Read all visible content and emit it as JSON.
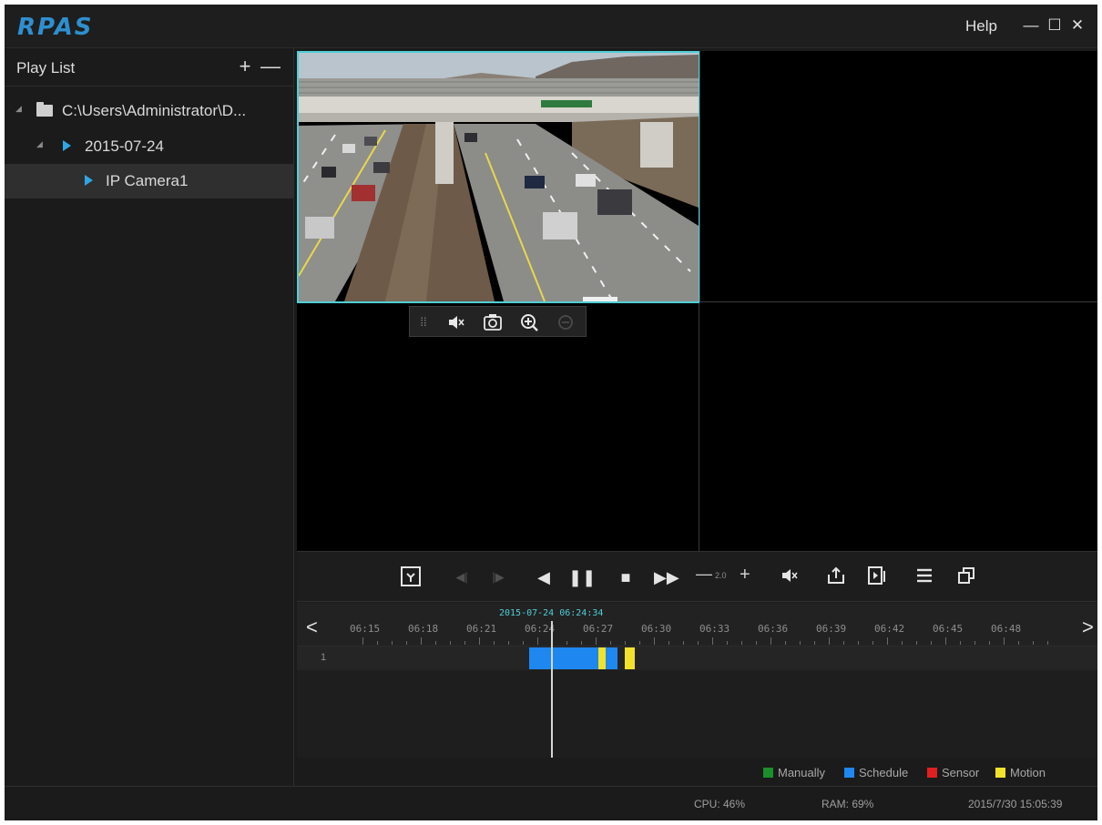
{
  "app": {
    "logo": "RPAS",
    "help": "Help"
  },
  "window_controls": {
    "minimize": "—",
    "maximize": "☐",
    "close": "✕"
  },
  "playlist": {
    "title": "Play List",
    "add": "+",
    "remove": "—",
    "tree": [
      {
        "label": "C:\\Users\\Administrator\\D...",
        "level": 0
      },
      {
        "label": "2015-07-24",
        "level": 1
      },
      {
        "label": "IP Camera1",
        "level": 2,
        "selected": true
      }
    ]
  },
  "video": {
    "sign_text": "",
    "overlay_toolbar": [
      "drag-handle",
      "mute",
      "snapshot",
      "zoom-in",
      "disabled"
    ]
  },
  "controls": {
    "speed_minus": "—",
    "speed_value": "2.0",
    "speed_plus": "+"
  },
  "timeline": {
    "current": "2015-07-24 06:24:34",
    "ticks": [
      "06:15",
      "06:18",
      "06:21",
      "06:24",
      "06:27",
      "06:30",
      "06:33",
      "06:36",
      "06:39",
      "06:42",
      "06:45",
      "06:48"
    ],
    "track_label": "1",
    "prev": "<",
    "next": ">",
    "segments": [
      {
        "type": "Schedule",
        "start": "06:23:35",
        "end": "06:28:08"
      },
      {
        "type": "Motion",
        "start": "06:27:08",
        "end": "06:27:30"
      },
      {
        "type": "Motion",
        "start": "06:28:30",
        "end": "06:29:00"
      }
    ]
  },
  "legend": [
    {
      "label": "Manually",
      "color": "#1a8f2a"
    },
    {
      "label": "Schedule",
      "color": "#1e87f0"
    },
    {
      "label": "Sensor",
      "color": "#e02020"
    },
    {
      "label": "Motion",
      "color": "#f2e22a"
    }
  ],
  "status": {
    "cpu": "CPU: 46%",
    "ram": "RAM: 69%",
    "datetime": "2015/7/30 15:05:39"
  }
}
